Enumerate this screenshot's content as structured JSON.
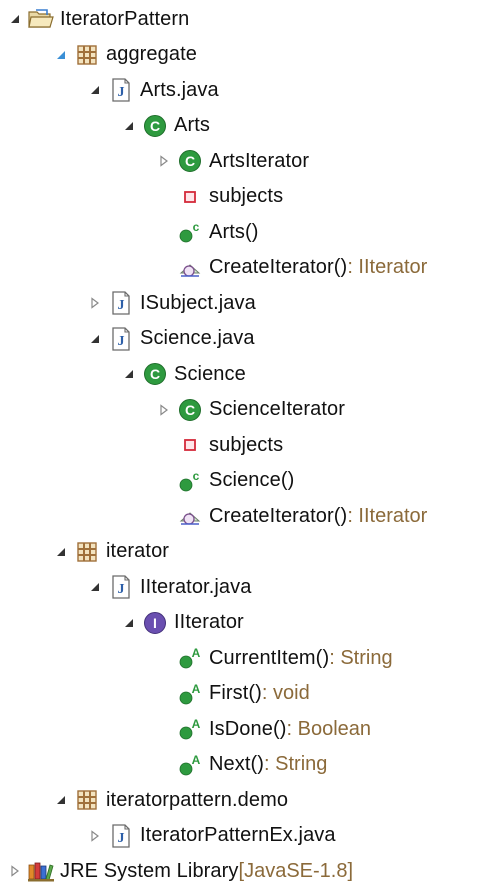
{
  "tree": [
    {
      "label": "IteratorPattern",
      "suffix": "",
      "icon": "project-folder-icon",
      "twisty": "expanded",
      "depth": 0,
      "name": "project-iteratorpattern"
    },
    {
      "label": "aggregate",
      "suffix": "",
      "icon": "package-icon",
      "twisty": "expanded-blue",
      "depth": 1,
      "name": "package-aggregate"
    },
    {
      "label": "Arts.java",
      "suffix": "",
      "icon": "java-file-icon",
      "twisty": "expanded",
      "depth": 2,
      "name": "file-arts-java"
    },
    {
      "label": "Arts",
      "suffix": "",
      "icon": "class-icon",
      "twisty": "expanded",
      "depth": 3,
      "name": "class-arts"
    },
    {
      "label": "ArtsIterator",
      "suffix": "",
      "icon": "class-icon",
      "twisty": "collapsed",
      "depth": 4,
      "name": "class-artsiterator"
    },
    {
      "label": "subjects",
      "suffix": "",
      "icon": "private-field-icon",
      "twisty": "none",
      "depth": 4,
      "name": "field-subjects-arts"
    },
    {
      "label": "Arts()",
      "suffix": "",
      "icon": "constructor-icon",
      "twisty": "none",
      "depth": 4,
      "name": "constructor-arts"
    },
    {
      "label": "CreateIterator()",
      "suffix": " : IIterator",
      "icon": "protected-method-icon",
      "twisty": "none",
      "depth": 4,
      "name": "method-createiterator-arts"
    },
    {
      "label": "ISubject.java",
      "suffix": "",
      "icon": "java-file-icon",
      "twisty": "collapsed",
      "depth": 2,
      "name": "file-isubject-java"
    },
    {
      "label": "Science.java",
      "suffix": "",
      "icon": "java-file-icon",
      "twisty": "expanded",
      "depth": 2,
      "name": "file-science-java"
    },
    {
      "label": "Science",
      "suffix": "",
      "icon": "class-icon",
      "twisty": "expanded",
      "depth": 3,
      "name": "class-science"
    },
    {
      "label": "ScienceIterator",
      "suffix": "",
      "icon": "class-icon",
      "twisty": "collapsed",
      "depth": 4,
      "name": "class-scienceiterator"
    },
    {
      "label": "subjects",
      "suffix": "",
      "icon": "private-field-icon",
      "twisty": "none",
      "depth": 4,
      "name": "field-subjects-science"
    },
    {
      "label": "Science()",
      "suffix": "",
      "icon": "constructor-icon",
      "twisty": "none",
      "depth": 4,
      "name": "constructor-science"
    },
    {
      "label": "CreateIterator()",
      "suffix": " : IIterator",
      "icon": "protected-method-icon",
      "twisty": "none",
      "depth": 4,
      "name": "method-createiterator-science"
    },
    {
      "label": "iterator",
      "suffix": "",
      "icon": "package-icon",
      "twisty": "expanded",
      "depth": 1,
      "name": "package-iterator"
    },
    {
      "label": "IIterator.java",
      "suffix": "",
      "icon": "java-file-icon",
      "twisty": "expanded",
      "depth": 2,
      "name": "file-iiterator-java"
    },
    {
      "label": "IIterator",
      "suffix": "",
      "icon": "interface-icon",
      "twisty": "expanded",
      "depth": 3,
      "name": "interface-iiterator"
    },
    {
      "label": "CurrentItem()",
      "suffix": " : String",
      "icon": "abstract-method-icon",
      "twisty": "none",
      "depth": 4,
      "name": "method-currentitem"
    },
    {
      "label": "First()",
      "suffix": " : void",
      "icon": "abstract-method-icon",
      "twisty": "none",
      "depth": 4,
      "name": "method-first"
    },
    {
      "label": "IsDone()",
      "suffix": " : Boolean",
      "icon": "abstract-method-icon",
      "twisty": "none",
      "depth": 4,
      "name": "method-isdone"
    },
    {
      "label": "Next()",
      "suffix": " : String",
      "icon": "abstract-method-icon",
      "twisty": "none",
      "depth": 4,
      "name": "method-next"
    },
    {
      "label": "iteratorpattern.demo",
      "suffix": "",
      "icon": "package-icon",
      "twisty": "expanded",
      "depth": 1,
      "name": "package-iteratorpattern-demo"
    },
    {
      "label": "IteratorPatternEx.java",
      "suffix": "",
      "icon": "java-file-icon",
      "twisty": "collapsed",
      "depth": 2,
      "name": "file-iteratorpatternex-java"
    },
    {
      "label": "JRE System Library",
      "suffix": " [JavaSE-1.8]",
      "icon": "library-icon",
      "twisty": "collapsed",
      "depth": 0,
      "name": "jre-system-library"
    }
  ],
  "colors": {
    "class_green": "#2e9a3f",
    "interface_purple": "#6a4fb0",
    "package_brown": "#a0703a",
    "field_red": "#d42a3a",
    "suffix_brown": "#8b6a3a",
    "twisty_dark": "#333333",
    "twisty_blue": "#3a8fd6",
    "java_blue": "#2d5fa8"
  }
}
